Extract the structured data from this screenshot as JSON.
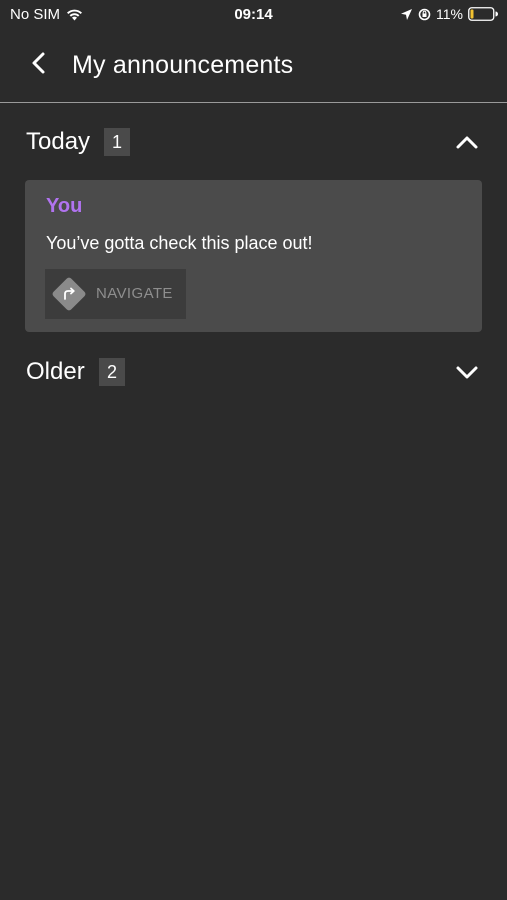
{
  "status_bar": {
    "carrier": "No SIM",
    "time": "09:14",
    "battery": "11%",
    "icons": [
      "wifi-icon",
      "location-icon",
      "orientation-lock-icon",
      "battery-icon"
    ],
    "battery_color": "#f2c230"
  },
  "header": {
    "title": "My announcements",
    "back_icon": "chevron-left-icon"
  },
  "sections": [
    {
      "title": "Today",
      "count": "1",
      "expanded": true,
      "announcements": [
        {
          "author": "You",
          "message": "You’ve gotta check this place out!",
          "action_label": "NAVIGATE",
          "action_icon": "directions-icon"
        }
      ]
    },
    {
      "title": "Older",
      "count": "2",
      "expanded": false,
      "announcements": []
    }
  ],
  "colors": {
    "background": "#2b2b2b",
    "card": "#4b4b4b",
    "author_accent": "#b173f0",
    "badge": "#4a4a4a"
  }
}
